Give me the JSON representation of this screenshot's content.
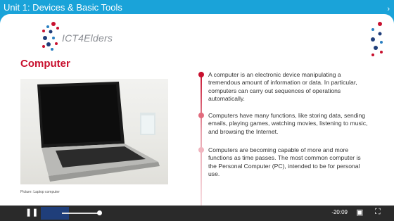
{
  "header": {
    "title": "Unit 1: Devices & Basic Tools",
    "more_icon": "chevron-right-icon"
  },
  "slide": {
    "logo_text": "ICT4Elders",
    "heading": "Computer",
    "photo_caption": "Picture: Laptop computer",
    "bullets": [
      "A computer is an electronic device manipulating a tremendous amount of information or data. In particular, computers can carry out sequences of operations automatically.",
      "Computers have many functions, like storing data, sending emails, playing games, watching movies, listening to music, and browsing the Internet.",
      "Computers are becoming capable of more and more functions as time passes. The most common computer is the Personal Computer (PC), intended to be for personal use."
    ],
    "accent_color": "#c8102e"
  },
  "player": {
    "time_remaining": "-20:09",
    "icons": [
      "pause-icon",
      "volume-icon",
      "picture-in-picture-icon",
      "fullscreen-icon"
    ]
  }
}
